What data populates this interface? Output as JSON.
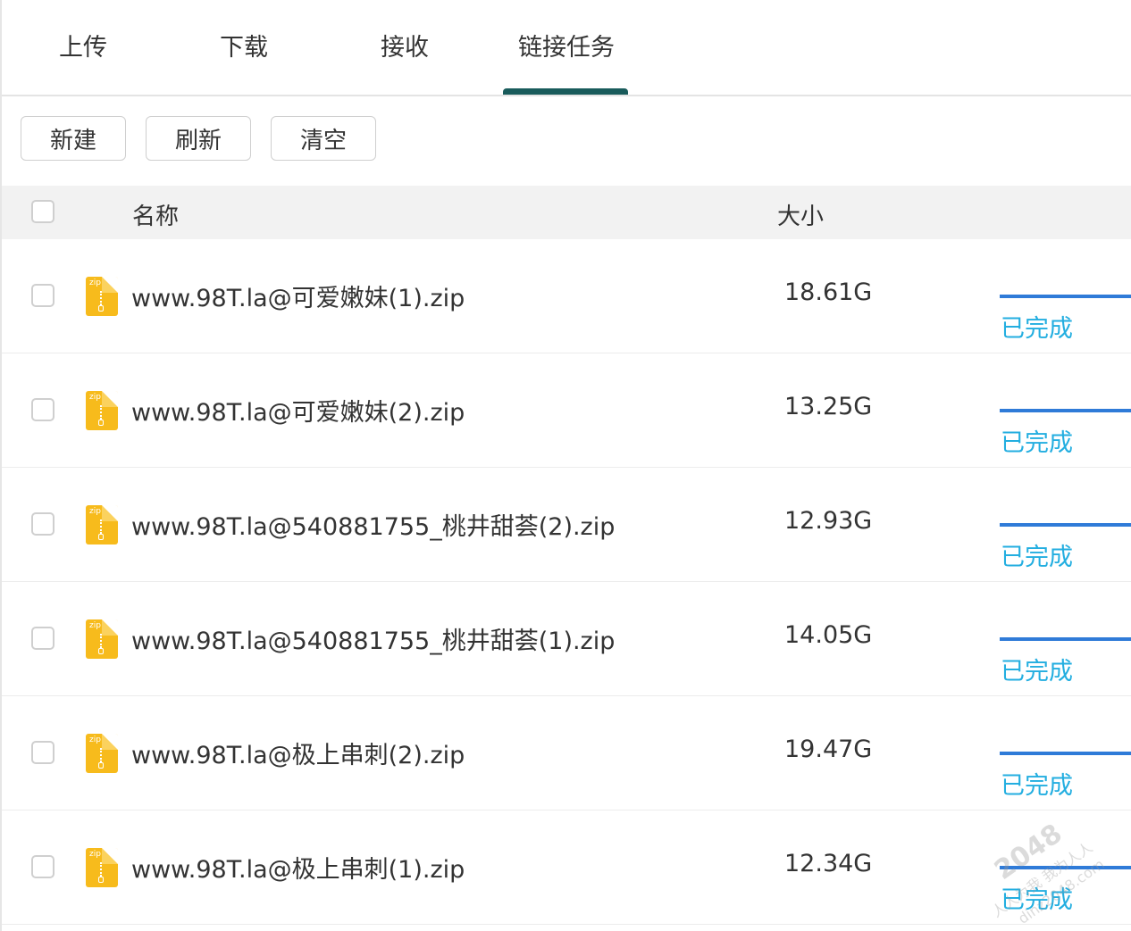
{
  "tabs": [
    {
      "label": "上传",
      "active": false
    },
    {
      "label": "下载",
      "active": false
    },
    {
      "label": "接收",
      "active": false
    },
    {
      "label": "链接任务",
      "active": true
    }
  ],
  "toolbar": {
    "new_label": "新建",
    "refresh_label": "刷新",
    "clear_label": "清空"
  },
  "table": {
    "columns": {
      "name": "名称",
      "size": "大小"
    },
    "rows": [
      {
        "name": "www.98T.la@可爱嫩妹(1).zip",
        "size": "18.61G",
        "status": "已完成",
        "progress": 1.0,
        "icon": "zip-file-icon"
      },
      {
        "name": "www.98T.la@可爱嫩妹(2).zip",
        "size": "13.25G",
        "status": "已完成",
        "progress": 1.0,
        "icon": "zip-file-icon"
      },
      {
        "name": "www.98T.la@540881755_桃井甜荟(2).zip",
        "size": "12.93G",
        "status": "已完成",
        "progress": 1.0,
        "icon": "zip-file-icon"
      },
      {
        "name": "www.98T.la@540881755_桃井甜荟(1).zip",
        "size": "14.05G",
        "status": "已完成",
        "progress": 1.0,
        "icon": "zip-file-icon"
      },
      {
        "name": "www.98T.la@极上串刺(2).zip",
        "size": "19.47G",
        "status": "已完成",
        "progress": 1.0,
        "icon": "zip-file-icon"
      },
      {
        "name": "www.98T.la@极上串刺(1).zip",
        "size": "12.34G",
        "status": "已完成",
        "progress": 1.0,
        "icon": "zip-file-icon"
      }
    ]
  },
  "colors": {
    "tab_indicator": "#195b5b",
    "progress": "#2f7bd8",
    "status": "#23aee0",
    "zip_icon": "#f7bb1c"
  },
  "watermark": {
    "line1": "2048",
    "line2": "人人为我 我为人人",
    "line3": "dinz2048.com"
  }
}
